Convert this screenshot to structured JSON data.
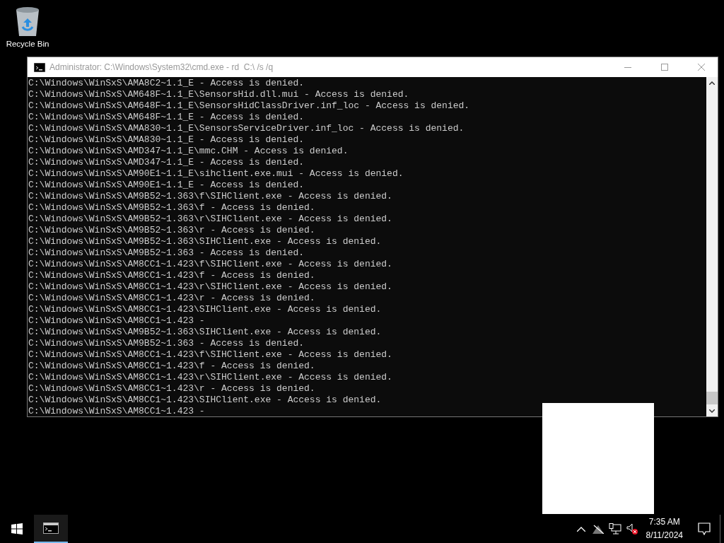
{
  "desktop": {
    "icons": [
      {
        "label": "Recycle Bin"
      }
    ]
  },
  "window": {
    "title": "Administrator: C:\\Windows\\System32\\cmd.exe - rd  C:\\ /s /q",
    "lines": [
      "C:\\Windows\\WinSxS\\AMA8C2~1.1_E - Access is denied.",
      "C:\\Windows\\WinSxS\\AM648F~1.1_E\\SensorsHid.dll.mui - Access is denied.",
      "C:\\Windows\\WinSxS\\AM648F~1.1_E\\SensorsHidClassDriver.inf_loc - Access is denied.",
      "C:\\Windows\\WinSxS\\AM648F~1.1_E - Access is denied.",
      "C:\\Windows\\WinSxS\\AMA830~1.1_E\\SensorsServiceDriver.inf_loc - Access is denied.",
      "C:\\Windows\\WinSxS\\AMA830~1.1_E - Access is denied.",
      "C:\\Windows\\WinSxS\\AMD347~1.1_E\\mmc.CHM - Access is denied.",
      "C:\\Windows\\WinSxS\\AMD347~1.1_E - Access is denied.",
      "C:\\Windows\\WinSxS\\AM90E1~1.1_E\\sihclient.exe.mui - Access is denied.",
      "C:\\Windows\\WinSxS\\AM90E1~1.1_E - Access is denied.",
      "C:\\Windows\\WinSxS\\AM9B52~1.363\\f\\SIHClient.exe - Access is denied.",
      "C:\\Windows\\WinSxS\\AM9B52~1.363\\f - Access is denied.",
      "C:\\Windows\\WinSxS\\AM9B52~1.363\\r\\SIHClient.exe - Access is denied.",
      "C:\\Windows\\WinSxS\\AM9B52~1.363\\r - Access is denied.",
      "C:\\Windows\\WinSxS\\AM9B52~1.363\\SIHClient.exe - Access is denied.",
      "C:\\Windows\\WinSxS\\AM9B52~1.363 - Access is denied.",
      "C:\\Windows\\WinSxS\\AM8CC1~1.423\\f\\SIHClient.exe - Access is denied.",
      "C:\\Windows\\WinSxS\\AM8CC1~1.423\\f - Access is denied.",
      "C:\\Windows\\WinSxS\\AM8CC1~1.423\\r\\SIHClient.exe - Access is denied.",
      "C:\\Windows\\WinSxS\\AM8CC1~1.423\\r - Access is denied.",
      "C:\\Windows\\WinSxS\\AM8CC1~1.423\\SIHClient.exe - Access is denied.",
      "C:\\Windows\\WinSxS\\AM8CC1~1.423 -",
      "C:\\Windows\\WinSxS\\AM9B52~1.363\\SIHClient.exe - Access is denied.",
      "C:\\Windows\\WinSxS\\AM9B52~1.363 - Access is denied.",
      "C:\\Windows\\WinSxS\\AM8CC1~1.423\\f\\SIHClient.exe - Access is denied.",
      "C:\\Windows\\WinSxS\\AM8CC1~1.423\\f - Access is denied.",
      "C:\\Windows\\WinSxS\\AM8CC1~1.423\\r\\SIHClient.exe - Access is denied.",
      "C:\\Windows\\WinSxS\\AM8CC1~1.423\\r - Access is denied.",
      "C:\\Windows\\WinSxS\\AM8CC1~1.423\\SIHClient.exe - Access is denied.",
      "C:\\Windows\\WinSxS\\AM8CC1~1.423 -"
    ]
  },
  "taskbar": {
    "apps": [
      {
        "kind": "cmd",
        "selected": true
      }
    ],
    "clock": {
      "time": "7:35 AM",
      "date": "8/11/2024"
    }
  }
}
